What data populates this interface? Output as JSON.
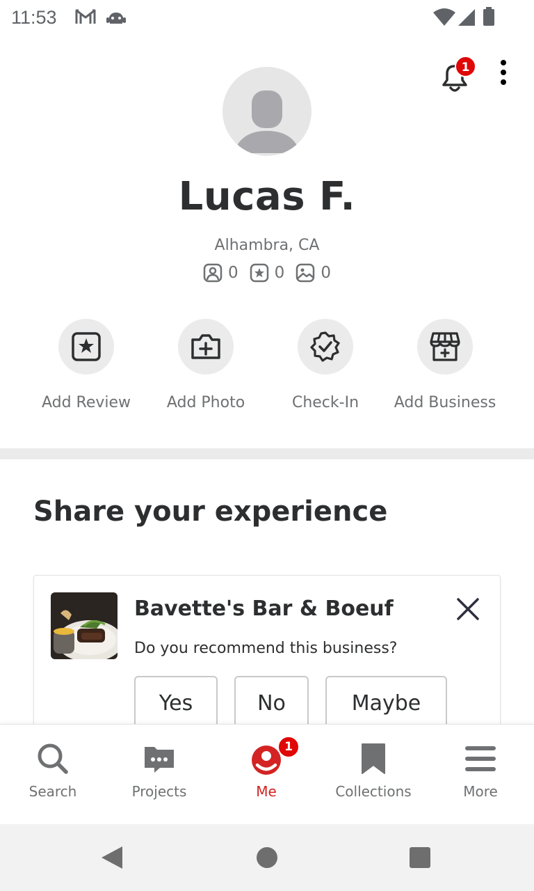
{
  "status_bar": {
    "time": "11:53",
    "icons": [
      "gmail-icon",
      "android-icon",
      "wifi-icon",
      "signal-icon",
      "battery-icon"
    ]
  },
  "header": {
    "notification_count": "1"
  },
  "profile": {
    "name": "Lucas F.",
    "location": "Alhambra, CA",
    "stats": [
      {
        "icon": "friends-icon",
        "value": "0"
      },
      {
        "icon": "reviews-icon",
        "value": "0"
      },
      {
        "icon": "photos-icon",
        "value": "0"
      }
    ]
  },
  "actions": [
    {
      "label": "Add Review",
      "icon": "star-square-icon"
    },
    {
      "label": "Add Photo",
      "icon": "camera-plus-icon"
    },
    {
      "label": "Check-In",
      "icon": "verified-badge-icon"
    },
    {
      "label": "Add Business",
      "icon": "storefront-plus-icon"
    }
  ],
  "share": {
    "title": "Share your experience",
    "card": {
      "business_name": "Bavette's Bar & Boeuf",
      "question": "Do you recommend this business?",
      "buttons": [
        "Yes",
        "No",
        "Maybe"
      ]
    }
  },
  "bottom_nav": {
    "items": [
      {
        "label": "Search",
        "icon": "search-icon"
      },
      {
        "label": "Projects",
        "icon": "projects-icon"
      },
      {
        "label": "Me",
        "icon": "me-icon",
        "badge": "1",
        "active": true
      },
      {
        "label": "Collections",
        "icon": "bookmark-icon"
      },
      {
        "label": "More",
        "icon": "menu-icon"
      }
    ]
  },
  "colors": {
    "brand_red": "#d32323",
    "badge_red": "#e00707",
    "text_dark": "#2d2e2f",
    "text_muted": "#6e7072"
  }
}
